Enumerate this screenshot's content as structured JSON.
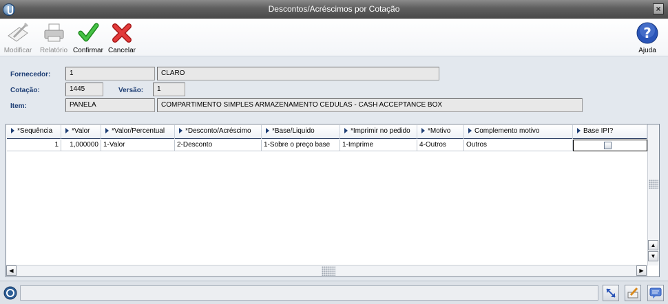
{
  "window": {
    "title": "Descontos/Acréscimos por Cotação",
    "close_symbol": "×"
  },
  "toolbar": {
    "modificar_label": "Modificar",
    "relatorio_label": "Relatório",
    "confirmar_label": "Confirmar",
    "cancelar_label": "Cancelar",
    "ajuda_label": "Ajuda"
  },
  "form": {
    "fornecedor_label": "Fornecedor:",
    "fornecedor_code": "1",
    "fornecedor_name": "CLARO",
    "cotacao_label": "Cotação:",
    "cotacao_value": "1445",
    "versao_label": "Versão:",
    "versao_value": "1",
    "item_label": "Item:",
    "item_code": "PANELA",
    "item_desc": "COMPARTIMENTO SIMPLES ARMAZENAMENTO CEDULAS - CASH ACCEPTANCE BOX"
  },
  "grid": {
    "columns": [
      "*Sequência",
      "*Valor",
      "*Valor/Percentual",
      "*Desconto/Acréscimo",
      "*Base/Liquido",
      "*Imprimir no pedido",
      "*Motivo",
      "Complemento motivo",
      "Base IPI?"
    ],
    "rows": [
      {
        "sequencia": "1",
        "valor": "1,000000",
        "valor_percentual": "1-Valor",
        "desconto_acrescimo": "2-Desconto",
        "base_liquido": "1-Sobre o preço base",
        "imprimir": "1-Imprime",
        "motivo": "4-Outros",
        "complemento": "Outros",
        "base_ipi": false
      }
    ],
    "scroll": {
      "up": "▲",
      "down": "▼",
      "left": "◀",
      "right": "▶"
    }
  },
  "colors": {
    "accent": "#1f3f75",
    "titlebar": "#5f5f5f",
    "confirm": "#2ea32e",
    "cancel": "#d62a2a",
    "help": "#2a55b8"
  },
  "icons": [
    "app-logo-icon",
    "modify-icon",
    "printer-icon",
    "checkmark-icon",
    "x-mark-icon",
    "help-icon",
    "status-logo-icon",
    "resize-icon",
    "edit-icon",
    "message-icon"
  ]
}
